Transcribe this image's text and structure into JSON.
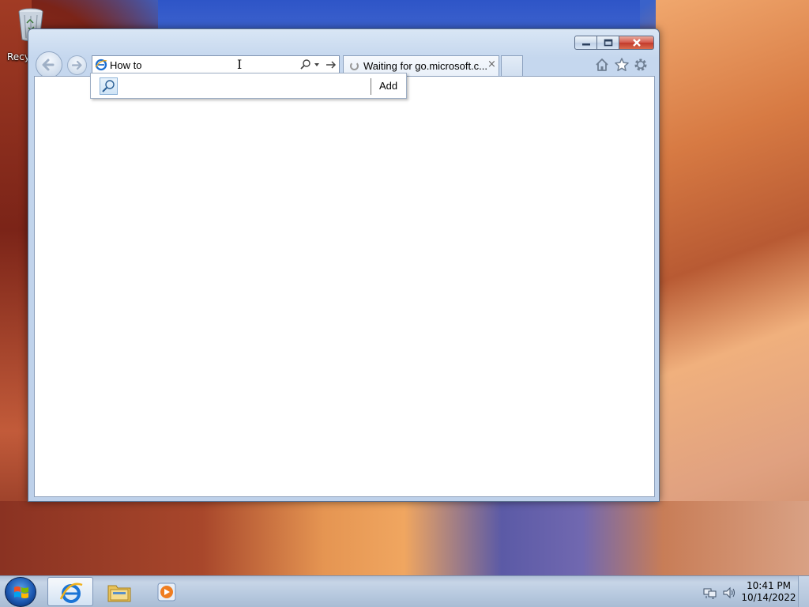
{
  "desktop": {
    "recycle_bin_label": "Recy"
  },
  "browser": {
    "address_value": "How to",
    "tab_title": "Waiting for go.microsoft.c...",
    "tab_close": "×",
    "suggest_add_label": "Add",
    "icons": {
      "back": "back-arrow-icon",
      "forward": "forward-arrow-icon",
      "home": "home-icon",
      "favorites": "star-icon",
      "tools": "gear-icon"
    }
  },
  "window_controls": {
    "minimize": "minimize-icon",
    "maximize": "maximize-icon",
    "close": "close-icon"
  },
  "taskbar": {
    "clock_time": "10:41 PM",
    "clock_date": "10/14/2022"
  },
  "colors": {
    "close_red": "#c23a2b",
    "window_frame": "#bed1ea",
    "taskbar": "#b7c9df"
  }
}
